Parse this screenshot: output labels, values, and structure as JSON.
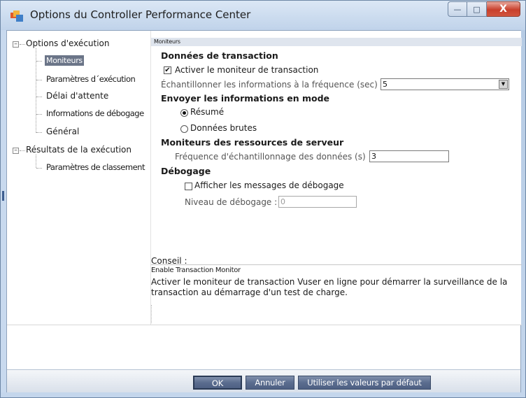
{
  "window": {
    "title": "Options du Controller Performance Center",
    "minimize_glyph": "—",
    "maximize_glyph": "□",
    "close_glyph": "X"
  },
  "tree": {
    "root1": {
      "label": "Options d'exécution",
      "expander": "–"
    },
    "items": [
      {
        "label": "Moniteurs",
        "selected": true
      },
      {
        "label": "Paramètres d´exécution"
      },
      {
        "label": "Délai d'attente"
      },
      {
        "label": "Informations de débogage"
      },
      {
        "label": "Général"
      }
    ],
    "root2": {
      "label": "Résultats de la exécution",
      "expander": "–"
    },
    "items2": [
      {
        "label": "Paramètres de classement"
      }
    ]
  },
  "pane": {
    "header": "Moniteurs",
    "section_transaction": "Données de transaction",
    "enable_monitor": {
      "label": "Activer le moniteur de transaction",
      "checked": true
    },
    "sample_rate_label": "Échantillonner les informations à la fréquence (sec)",
    "sample_rate_value": "5",
    "section_send": "Envoyer les informations en mode",
    "radio_summary": {
      "label": "Résumé",
      "selected": true
    },
    "radio_raw": {
      "label": "Données brutes",
      "selected": false
    },
    "section_server": "Moniteurs des ressources de serveur",
    "server_freq_label": "Fréquence d'échantillonnage des données (s)",
    "server_freq_value": "3",
    "section_debug": "Débogage",
    "show_debug": {
      "label": "Afficher les messages de débogage",
      "checked": false
    },
    "debug_level_label": "Niveau de débogage :",
    "debug_level_value": "0"
  },
  "hint": {
    "title": "Conseil :",
    "subtitle": "Enable Transaction Monitor",
    "body": "Activer le moniteur de transaction Vuser en ligne pour démarrer la surveillance de la transaction au démarrage d'un test de charge."
  },
  "buttons": {
    "ok": "OK",
    "cancel": "Annuler",
    "defaults": "Utiliser les valeurs par défaut"
  }
}
